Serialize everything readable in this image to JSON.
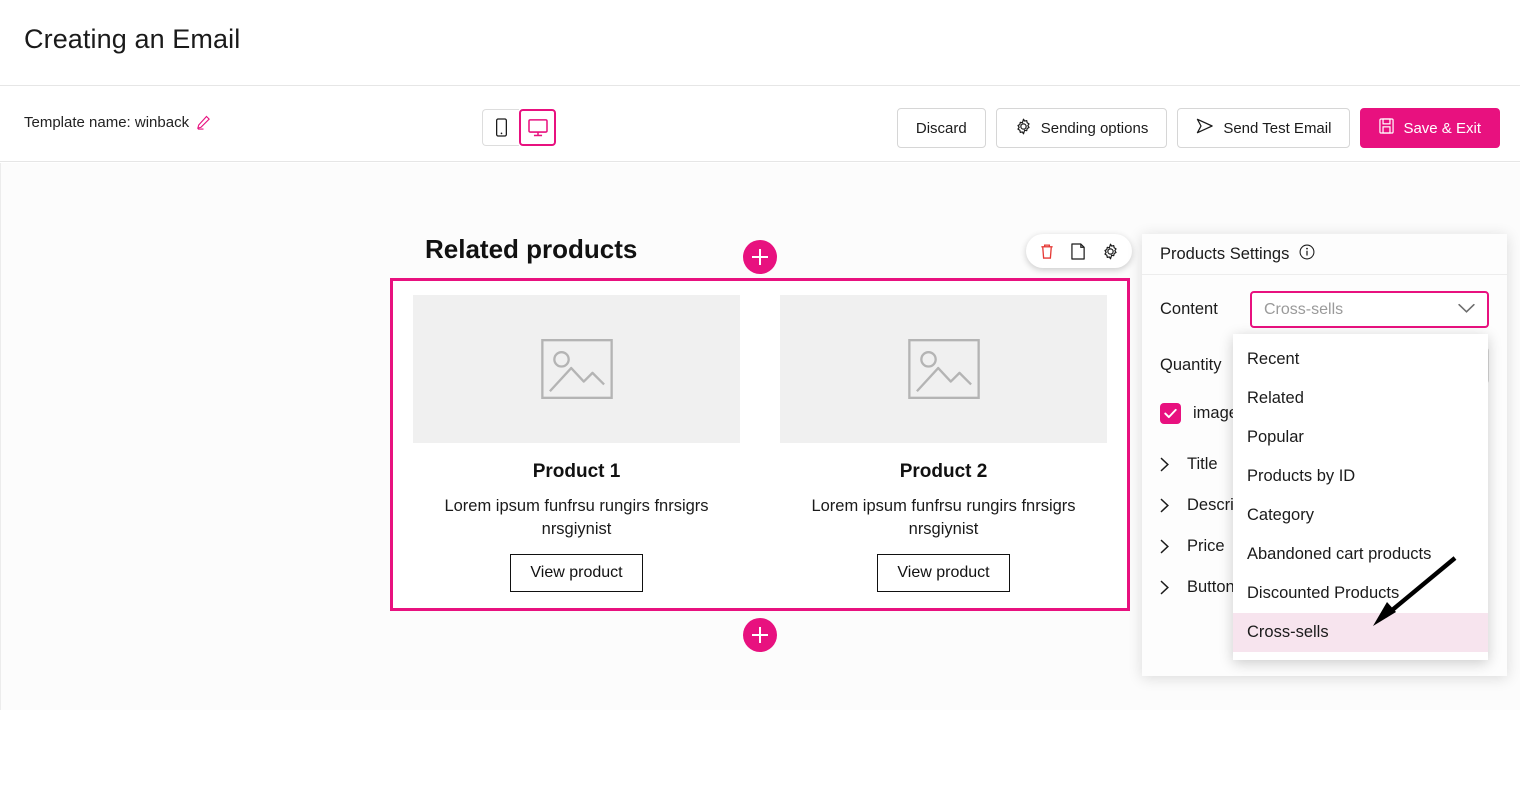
{
  "header": {
    "title": "Creating an Email"
  },
  "toolbar": {
    "template_label": "Template name: winback",
    "edit_icon": "pencil-icon",
    "device_mobile_icon": "mobile-icon",
    "device_desktop_icon": "desktop-icon",
    "discard_label": "Discard",
    "sending_options_label": "Sending options",
    "sending_options_icon": "gear-icon",
    "send_test_label": "Send Test Email",
    "send_test_icon": "send-icon",
    "save_exit_label": "Save & Exit",
    "save_exit_icon": "save-icon"
  },
  "canvas": {
    "section_heading": "Related products",
    "add_above_icon": "plus-icon",
    "add_below_icon": "plus-icon",
    "block_toolbar": {
      "delete_icon": "trash-icon",
      "duplicate_icon": "duplicate-icon",
      "settings_icon": "gear-icon"
    },
    "products": [
      {
        "image_placeholder_icon": "image-icon",
        "title": "Product 1",
        "description": "Lorem ipsum funfrsu rungirs fnrsigrs nrsgiynist",
        "button_label": "View product"
      },
      {
        "image_placeholder_icon": "image-icon",
        "title": "Product 2",
        "description": "Lorem ipsum funfrsu rungirs fnrsigrs nrsgiynist",
        "button_label": "View product"
      }
    ]
  },
  "settings_panel": {
    "title": "Products Settings",
    "info_icon": "info-icon",
    "content_label": "Content",
    "content_value": "Cross-sells",
    "content_chevron_icon": "chevron-down-icon",
    "quantity_label": "Quantity",
    "quantity_value": "",
    "image_checkbox_label": "image",
    "image_checkbox_checked": true,
    "check_icon": "check-icon",
    "accordion_rows": [
      {
        "label": "Title",
        "icon": "chevron-right-icon"
      },
      {
        "label": "Description",
        "icon": "chevron-right-icon"
      },
      {
        "label": "Price",
        "icon": "chevron-right-icon"
      },
      {
        "label": "Button",
        "icon": "chevron-right-icon"
      }
    ]
  },
  "dropdown": {
    "options": [
      "Recent",
      "Related",
      "Popular",
      "Products by ID",
      "Category",
      "Abandoned cart products",
      "Discounted Products",
      "Cross-sells"
    ],
    "selected": "Cross-sells"
  },
  "annotation": {
    "arrow_icon": "arrow-pointer-icon"
  },
  "colors": {
    "accent": "#E8117F",
    "selected_row": "#f7e4ee",
    "delete": "#E53935"
  }
}
